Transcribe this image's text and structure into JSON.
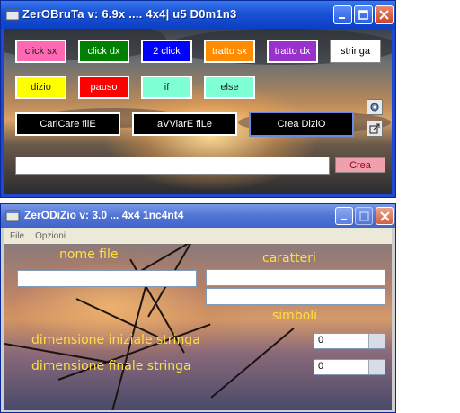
{
  "window1": {
    "title": "ZerOBruTa v: 6.9x .... 4x4| u5 D0m1n3",
    "row1": [
      {
        "label": "click sx",
        "bg": "#ff69b4",
        "fg": "#222222"
      },
      {
        "label": "click dx",
        "bg": "#008000",
        "fg": "#ffffff"
      },
      {
        "label": "2 click",
        "bg": "#0000ff",
        "fg": "#ffffff"
      },
      {
        "label": "tratto sx",
        "bg": "#ff8c00",
        "fg": "#ffffff"
      },
      {
        "label": "tratto dx",
        "bg": "#9932cc",
        "fg": "#ffffff"
      },
      {
        "label": "stringa",
        "bg": "#ffffff",
        "fg": "#000000"
      }
    ],
    "row2": [
      {
        "label": "dizio",
        "bg": "#ffff00",
        "fg": "#222222"
      },
      {
        "label": "pauso",
        "bg": "#ff0000",
        "fg": "#ffffff"
      },
      {
        "label": "if",
        "bg": "#7fffd4",
        "fg": "#222222"
      },
      {
        "label": "else",
        "bg": "#7fffd4",
        "fg": "#222222"
      }
    ],
    "row3": [
      {
        "label": "CariCare filE"
      },
      {
        "label": "aVViarE fiLe"
      },
      {
        "label": "Crea DiziO"
      }
    ],
    "input_value": "",
    "crea_label": "Crea"
  },
  "window2": {
    "title": "ZerODiZio v: 3.0 ... 4x4 1nc4nt4",
    "menu": [
      "File",
      "Opzioni"
    ],
    "labels": {
      "nome_file": "nome file",
      "caratteri": "caratteri",
      "simboli": "simboli",
      "dim_iniziale": "dimensione iniziale stringa",
      "dim_finale": "dimensione finale stringa"
    },
    "nome_file_value": "",
    "caratteri_value_1": "",
    "caratteri_value_2": "",
    "dim_iniziale_value": "0",
    "dim_finale_value": "0"
  }
}
